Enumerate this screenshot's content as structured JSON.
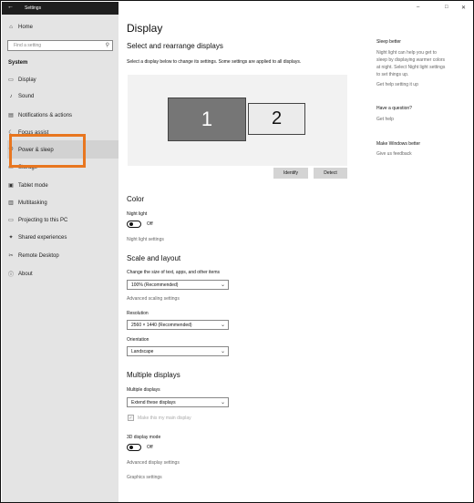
{
  "window": {
    "title": "Settings",
    "minimize": "–",
    "maximize": "□",
    "close": "✕"
  },
  "sidebar": {
    "back": "←",
    "home": "Home",
    "search_placeholder": "Find a setting",
    "section": "System",
    "items": [
      {
        "label": "Display",
        "icon": "monitor-icon",
        "glyph": "▭"
      },
      {
        "label": "Sound",
        "icon": "speaker-icon",
        "glyph": "♪"
      },
      {
        "label": "Notifications & actions",
        "icon": "notifications-icon",
        "glyph": "▤"
      },
      {
        "label": "Focus assist",
        "icon": "moon-icon",
        "glyph": "☾"
      },
      {
        "label": "Power & sleep",
        "icon": "power-icon",
        "glyph": "⏻"
      },
      {
        "label": "Storage",
        "icon": "storage-icon",
        "glyph": "▭"
      },
      {
        "label": "Tablet mode",
        "icon": "tablet-icon",
        "glyph": "▣"
      },
      {
        "label": "Multitasking",
        "icon": "multitasking-icon",
        "glyph": "▥"
      },
      {
        "label": "Projecting to this PC",
        "icon": "projector-icon",
        "glyph": "▭"
      },
      {
        "label": "Shared experiences",
        "icon": "share-icon",
        "glyph": "✦"
      },
      {
        "label": "Remote Desktop",
        "icon": "remote-icon",
        "glyph": "✂"
      },
      {
        "label": "About",
        "icon": "info-icon",
        "glyph": "ⓘ"
      }
    ]
  },
  "main": {
    "title": "Display",
    "arrange_heading": "Select and rearrange displays",
    "arrange_desc": "Select a display below to change its settings. Some settings are applied to all displays.",
    "monitor1": "1",
    "monitor2": "2",
    "identify": "Identify",
    "detect": "Detect",
    "color_heading": "Color",
    "night_light_label": "Night light",
    "night_light_state": "Off",
    "night_light_settings": "Night light settings",
    "scale_heading": "Scale and layout",
    "scale_label": "Change the size of text, apps, and other items",
    "scale_value": "100% (Recommended)",
    "advanced_scaling": "Advanced scaling settings",
    "resolution_label": "Resolution",
    "resolution_value": "2560 × 1440 (Recommended)",
    "orientation_label": "Orientation",
    "orientation_value": "Landscape",
    "multiple_heading": "Multiple displays",
    "multiple_label": "Multiple displays",
    "multiple_value": "Extend these displays",
    "main_display_label": "Make this my main display",
    "mode3d_label": "3D display mode",
    "mode3d_state": "Off",
    "advanced_display": "Advanced display settings",
    "graphics_settings": "Graphics settings"
  },
  "right_panel": {
    "sleep_heading": "Sleep better",
    "sleep_text_1": "Night light can help you get to",
    "sleep_text_2": "sleep by displaying warmer colors",
    "sleep_text_3": "at night. Select Night light settings",
    "sleep_text_4": "to set things up.",
    "sleep_link": "Get help setting it up",
    "question_heading": "Have a question?",
    "question_link": "Get help",
    "better_heading": "Make Windows better",
    "better_link": "Give us feedback"
  },
  "colors": {
    "highlight": "#e8761f",
    "sidebar_bg": "#e4e4e4",
    "selected_monitor": "#767676"
  }
}
